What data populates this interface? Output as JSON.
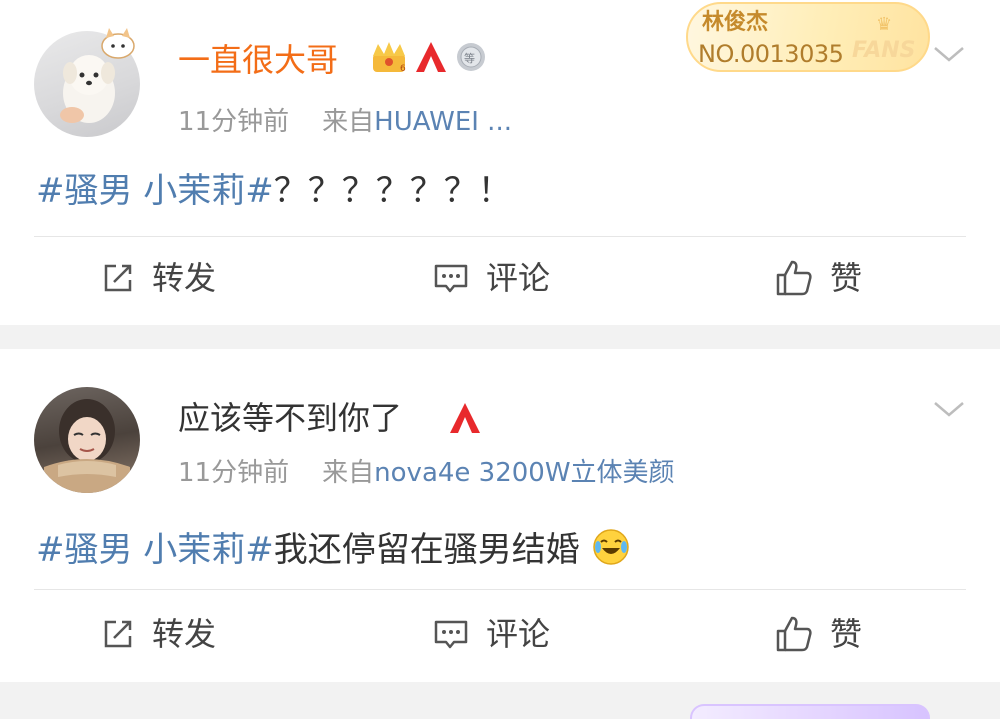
{
  "posts": [
    {
      "username": "一直很大哥",
      "time": "11分钟前",
      "source_prefix": "来自",
      "source": "HUAWEI ...",
      "hashtag": "#骚男 小茉莉#",
      "content": "？？？？？？！",
      "fans_card": {
        "name": "林俊杰",
        "number": "NO.0013035",
        "label": "FANS"
      },
      "actions": {
        "repost": "转发",
        "comment": "评论",
        "like": "赞"
      }
    },
    {
      "username": "应该等不到你了",
      "time": "11分钟前",
      "source_prefix": "来自",
      "source": "nova4e 3200W立体美颜",
      "hashtag": "#骚男 小茉莉#",
      "content": "我还停留在骚男结婚",
      "actions": {
        "repost": "转发",
        "comment": "评论",
        "like": "赞"
      }
    }
  ],
  "colors": {
    "vip_orange": "#f36d17",
    "hashtag_blue": "#507daf",
    "source_blue": "#5b83b3",
    "gray_text": "#999999",
    "separator": "#f2f2f2"
  },
  "icons": [
    "crown-icon",
    "red-a-icon",
    "medal-icon",
    "chevron-down-icon",
    "repost-icon",
    "comment-icon",
    "like-icon",
    "laugh-cry-emoji-icon"
  ]
}
